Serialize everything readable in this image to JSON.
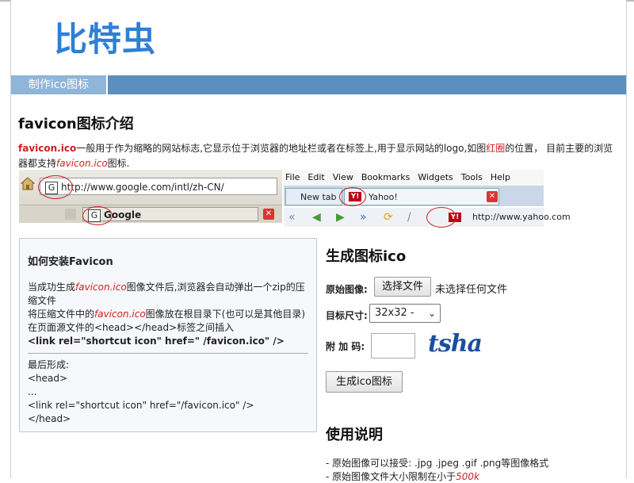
{
  "site": {
    "logo": "比特虫"
  },
  "nav": {
    "tab": "制作ico图标"
  },
  "intro": {
    "title": "favicon图标介绍",
    "text_a": "favicon.ico",
    "text_b": "一般用于作为缩略的网站标志,它显示位于浏览器的地址栏或者在标签上,用于显示网站的logo,如图",
    "text_c": "红圈",
    "text_d": "的位置，  目前主要的浏览器都支持",
    "text_e": "favicon.ico",
    "text_f": "图标."
  },
  "browser": {
    "ff_url": "http://www.google.com/intl/zh-CN/",
    "ff_tab": "Google",
    "menu": [
      "File",
      "Edit",
      "View",
      "Bookmarks",
      "Widgets",
      "Tools",
      "Help"
    ],
    "ie_tab1": "New tab",
    "ie_tab2": "Yahoo!",
    "ie_url": "http://www.yahoo.com",
    "g_glyph": "G",
    "y_glyph": "Y!"
  },
  "install": {
    "title": "如何安装Favicon",
    "l1a": "当成功生成",
    "l1b": "favicon.ico",
    "l1c": "图像文件后,浏览器会自动弹出一个zip的压缩文件",
    "l2a": "将压缩文件中的",
    "l2b": "favicon.ico",
    "l2c": "图像放在根目录下(也可以是其他目录)",
    "l3": "在页面源文件的<head></head>标签之间插入",
    "l4": "<link rel=\"shortcut icon\" href=\" /favicon.ico\" />",
    "l5": "最后形成:",
    "l6": "<head>",
    "l7": "...",
    "l8": "<link rel=\"shortcut icon\" href=\"/favicon.ico\" />",
    "l9": "</head>"
  },
  "form": {
    "title": "生成图标ico",
    "image_label": "原始图像:",
    "choose_btn": "选择文件",
    "no_file": "未选择任何文件",
    "size_label": "目标尺寸:",
    "size_value": "32x32 -",
    "code_label": "附 加 码:",
    "captcha": "tsha",
    "submit": "生成ico图标"
  },
  "usage": {
    "title": "使用说明",
    "l1": "- 原始图像可以接受: .jpg .jpeg .gif .png等图像格式",
    "l2a": "- 原始图像文件大小限制在小于",
    "l2b": "500k"
  },
  "colors": {
    "accent": "#2f7fd6",
    "nav": "#5a8fbf",
    "nav_tab": "#8fb5d8",
    "highlight": "#cc2222"
  }
}
